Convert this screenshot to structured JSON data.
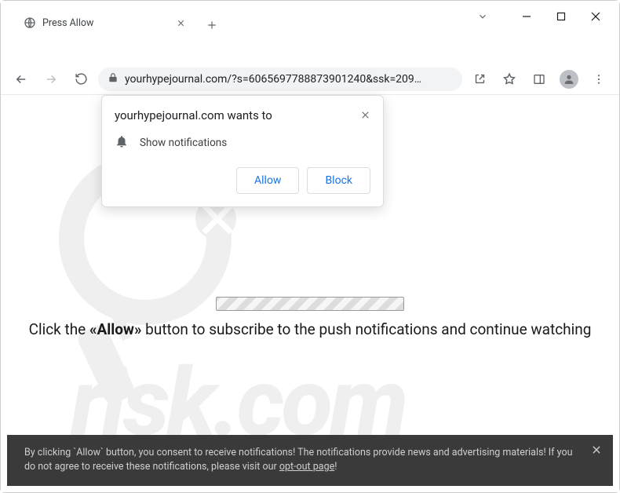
{
  "window": {
    "tab_title": "Press Allow",
    "url_display": "yourhypejournal.com/?s=6065697788873901240&ssk=209…"
  },
  "permission": {
    "origin_wants_to": "yourhypejournal.com wants to",
    "item_label": "Show notifications",
    "allow_label": "Allow",
    "block_label": "Block"
  },
  "page": {
    "instruction_pre": "Click the ",
    "instruction_allow": "«Allow»",
    "instruction_post": " button to subscribe to the push notifications and continue watching"
  },
  "consent": {
    "text_pre": "By clicking `Allow` button, you consent to receive notifications! The notifications provide news and advertising materials! If you do not agree to receive these notifications, please visit our ",
    "link_text": "opt-out page",
    "text_post": "!"
  },
  "watermark": {
    "text": "pcrisk.com"
  }
}
